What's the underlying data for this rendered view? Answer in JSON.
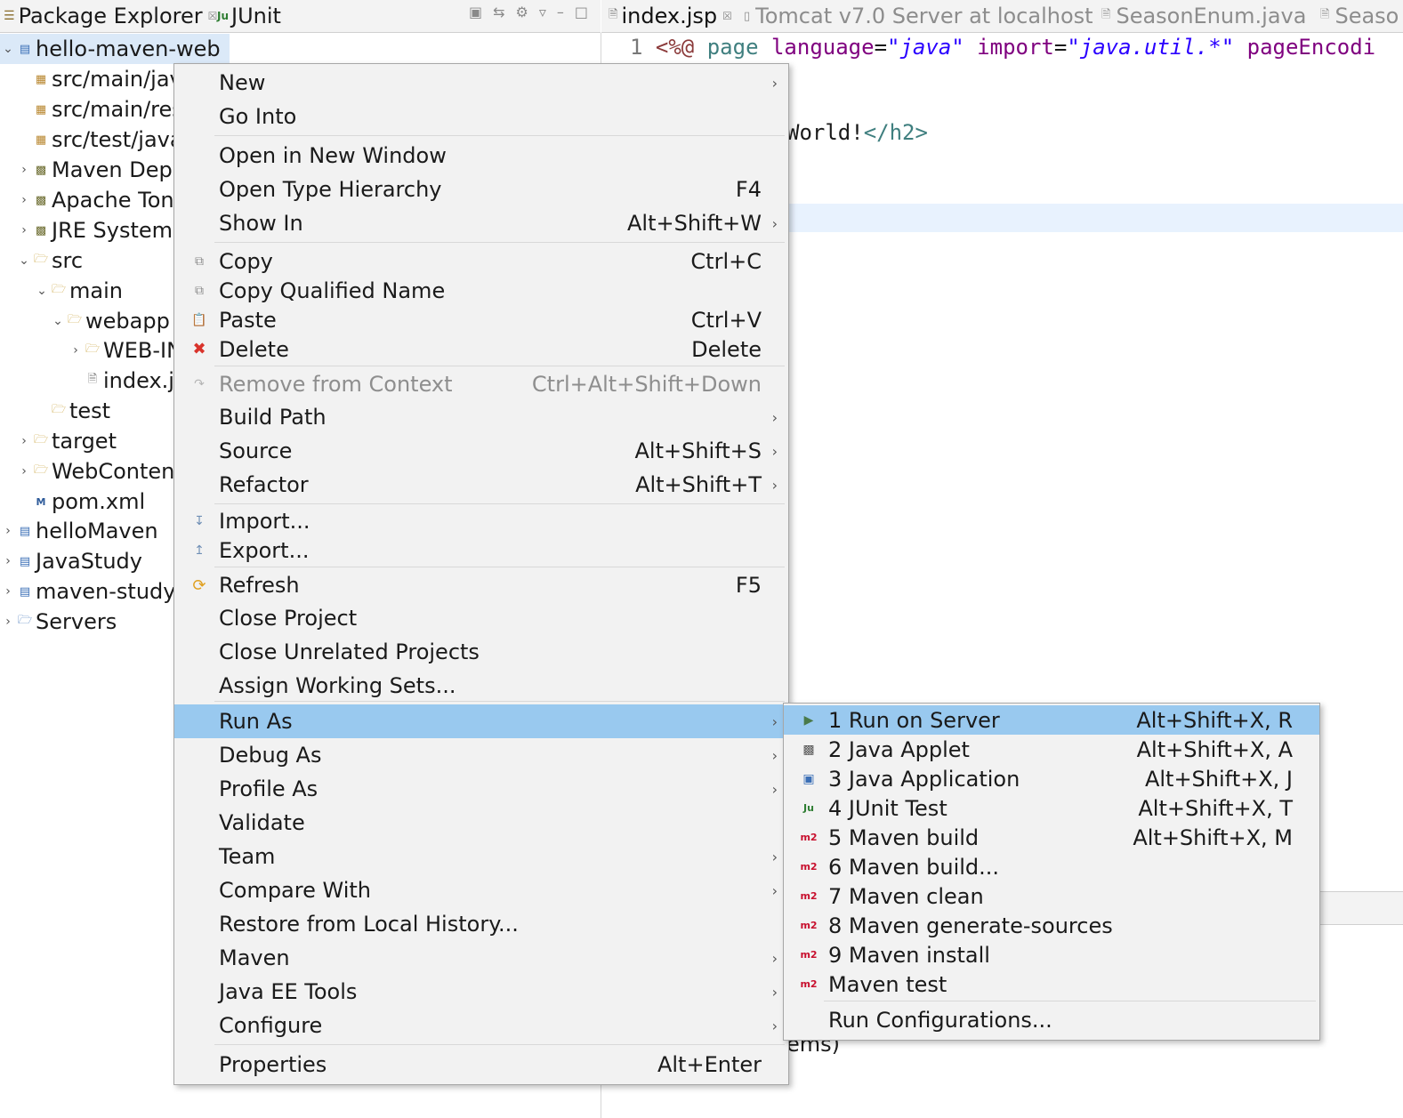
{
  "explorer": {
    "tabs": [
      {
        "label": "Package Explorer",
        "close": "☒"
      },
      {
        "label": "JUnit"
      }
    ],
    "tree": [
      {
        "label": "hello-maven-web"
      },
      {
        "label": "src/main/jav"
      },
      {
        "label": "src/main/res"
      },
      {
        "label": "src/test/java"
      },
      {
        "label": "Maven Depe"
      },
      {
        "label": "Apache Ton"
      },
      {
        "label": "JRE System"
      },
      {
        "label": "src"
      },
      {
        "label": "main"
      },
      {
        "label": "webapp"
      },
      {
        "label": "WEB-IN"
      },
      {
        "label": "index.js"
      },
      {
        "label": "test"
      },
      {
        "label": "target"
      },
      {
        "label": "WebConten"
      },
      {
        "label": "pom.xml"
      },
      {
        "label": "helloMaven"
      },
      {
        "label": "JavaStudy"
      },
      {
        "label": "maven-study"
      },
      {
        "label": "Servers"
      }
    ]
  },
  "editor": {
    "tabs": [
      {
        "label": "index.jsp"
      },
      {
        "label": "Tomcat v7.0 Server at localhost"
      },
      {
        "label": "SeasonEnum.java"
      },
      {
        "label": "Seaso"
      }
    ],
    "line1": {
      "num": "1",
      "open": "<%@",
      "kw_page": "page",
      "attr1": "language",
      "eq": "=",
      "val1": "\"java\"",
      "attr2": "import",
      "val2": "\"java.util.*\"",
      "attr3": "pageEncodi"
    },
    "line3": {
      "text": "World!",
      "tag": "</h2>"
    },
    "bottom_text": "ems)"
  },
  "context_menu": {
    "items": [
      {
        "label": "New",
        "arrow": "›"
      },
      {
        "label": "Go Into"
      },
      {
        "label": "Open in New Window"
      },
      {
        "label": "Open Type Hierarchy",
        "shortcut": "F4"
      },
      {
        "label": "Show In",
        "shortcut": "Alt+Shift+W",
        "arrow": "›"
      },
      {
        "label": "Copy",
        "shortcut": "Ctrl+C"
      },
      {
        "label": "Copy Qualified Name"
      },
      {
        "label": "Paste",
        "shortcut": "Ctrl+V"
      },
      {
        "label": "Delete",
        "shortcut": "Delete"
      },
      {
        "label": "Remove from Context",
        "shortcut": "Ctrl+Alt+Shift+Down"
      },
      {
        "label": "Build Path",
        "arrow": "›"
      },
      {
        "label": "Source",
        "shortcut": "Alt+Shift+S",
        "arrow": "›"
      },
      {
        "label": "Refactor",
        "shortcut": "Alt+Shift+T",
        "arrow": "›"
      },
      {
        "label": "Import..."
      },
      {
        "label": "Export..."
      },
      {
        "label": "Refresh",
        "shortcut": "F5"
      },
      {
        "label": "Close Project"
      },
      {
        "label": "Close Unrelated Projects"
      },
      {
        "label": "Assign Working Sets..."
      },
      {
        "label": "Run As",
        "arrow": "›"
      },
      {
        "label": "Debug As",
        "arrow": "›"
      },
      {
        "label": "Profile As",
        "arrow": "›"
      },
      {
        "label": "Validate"
      },
      {
        "label": "Team",
        "arrow": "›"
      },
      {
        "label": "Compare With",
        "arrow": "›"
      },
      {
        "label": "Restore from Local History..."
      },
      {
        "label": "Maven",
        "arrow": "›"
      },
      {
        "label": "Java EE Tools",
        "arrow": "›"
      },
      {
        "label": "Configure",
        "arrow": "›"
      },
      {
        "label": "Properties",
        "shortcut": "Alt+Enter"
      }
    ]
  },
  "run_as_menu": {
    "items": [
      {
        "label": "1 Run on Server",
        "shortcut": "Alt+Shift+X, R"
      },
      {
        "label": "2 Java Applet",
        "shortcut": "Alt+Shift+X, A"
      },
      {
        "label": "3 Java Application",
        "shortcut": "Alt+Shift+X, J"
      },
      {
        "label": "4 JUnit Test",
        "shortcut": "Alt+Shift+X, T"
      },
      {
        "label": "5 Maven build",
        "shortcut": "Alt+Shift+X, M"
      },
      {
        "label": "6 Maven build..."
      },
      {
        "label": "7 Maven clean"
      },
      {
        "label": "8 Maven generate-sources"
      },
      {
        "label": "9 Maven install"
      },
      {
        "label": "Maven test"
      },
      {
        "label": "Run Configurations..."
      }
    ],
    "icon_text": {
      "junit": "Ju",
      "m2": "m2"
    }
  },
  "colors": {
    "selection": "#dbe9f8",
    "menu_highlight": "#99c9ef",
    "jsp_tag": "#8b3a3a",
    "jsp_keyword": "#3f7f7f",
    "attr_name": "#7f007f",
    "attr_value": "#2a00ff",
    "m2_red": "#c8102e"
  }
}
